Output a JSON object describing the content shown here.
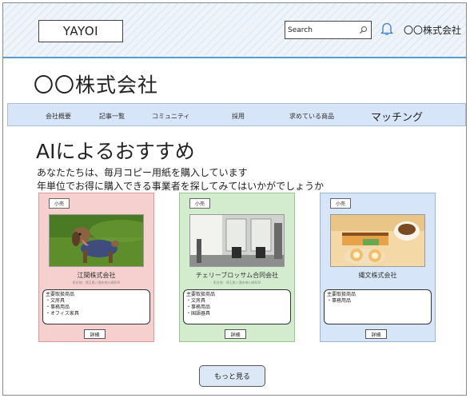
{
  "header": {
    "logo": "YAYOI",
    "search_placeholder": "Search",
    "company_link": "〇〇株式会社"
  },
  "company_title": "〇〇株式会社",
  "nav": {
    "items": [
      "会社概要",
      "記事一覧",
      "コミュニティ",
      "採用",
      "求めている商品",
      "マッチング"
    ]
  },
  "recommend": {
    "title": "AIによるおすすめ",
    "lead_line1": "あなたたちは、毎月コピー用紙を購入しています",
    "lead_line2": "年単位でお得に購入できる事業者を探してみてはいかがでしょうか",
    "cards": [
      {
        "badge": "小売",
        "image": "dog-photo",
        "name": "江間株式会社",
        "address": "所在地：埼玉県八潮市南川崎600",
        "goods": [
          "主要取扱商品",
          "・文房具",
          "・事務用品",
          "・オフィス家具"
        ],
        "detail": "詳細",
        "color": "#f6cfcf"
      },
      {
        "badge": "小売",
        "image": "salon-interior-photo",
        "name": "チェリーブロッサム合同会社",
        "address": "所在地：埼玉県八潮市南川崎600",
        "goods": [
          "主要取扱商品",
          "・文房具",
          "・事務用品",
          "・国語器具"
        ],
        "detail": "詳細",
        "color": "#d4ecce"
      },
      {
        "badge": "小売",
        "image": "cake-photo",
        "name": "縄文株式会社",
        "address": "",
        "goods": [
          "主要取扱商品",
          "・事務用品"
        ],
        "detail": "詳細",
        "color": "#d6e5f8"
      }
    ],
    "more_button": "もっと見る"
  }
}
